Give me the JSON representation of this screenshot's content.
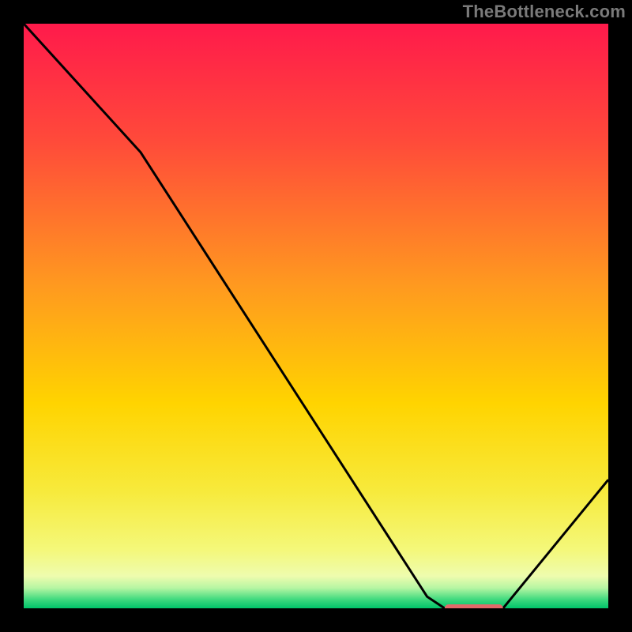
{
  "watermark": "TheBottleneck.com",
  "chart_data": {
    "type": "line",
    "title": "",
    "xlabel": "",
    "ylabel": "",
    "xlim": [
      0,
      100
    ],
    "ylim": [
      0,
      100
    ],
    "grid": false,
    "series": [
      {
        "name": "curve",
        "x": [
          0,
          20,
          69,
          72,
          82,
          100
        ],
        "y": [
          100,
          78,
          2,
          0,
          0,
          22
        ]
      }
    ],
    "highlight_segment": {
      "x0": 72,
      "x1": 82,
      "y": 0
    },
    "gradient_stops": [
      {
        "offset": 0.0,
        "color": "#ff1a4b"
      },
      {
        "offset": 0.2,
        "color": "#ff4a3a"
      },
      {
        "offset": 0.45,
        "color": "#ff9a1f"
      },
      {
        "offset": 0.65,
        "color": "#ffd400"
      },
      {
        "offset": 0.8,
        "color": "#f7ea3c"
      },
      {
        "offset": 0.9,
        "color": "#f4f87a"
      },
      {
        "offset": 0.945,
        "color": "#eefcae"
      },
      {
        "offset": 0.965,
        "color": "#b7f6a3"
      },
      {
        "offset": 0.985,
        "color": "#3fd97e"
      },
      {
        "offset": 1.0,
        "color": "#00c46a"
      }
    ],
    "line_color": "#000000",
    "highlight_color": "#e26a6a"
  }
}
